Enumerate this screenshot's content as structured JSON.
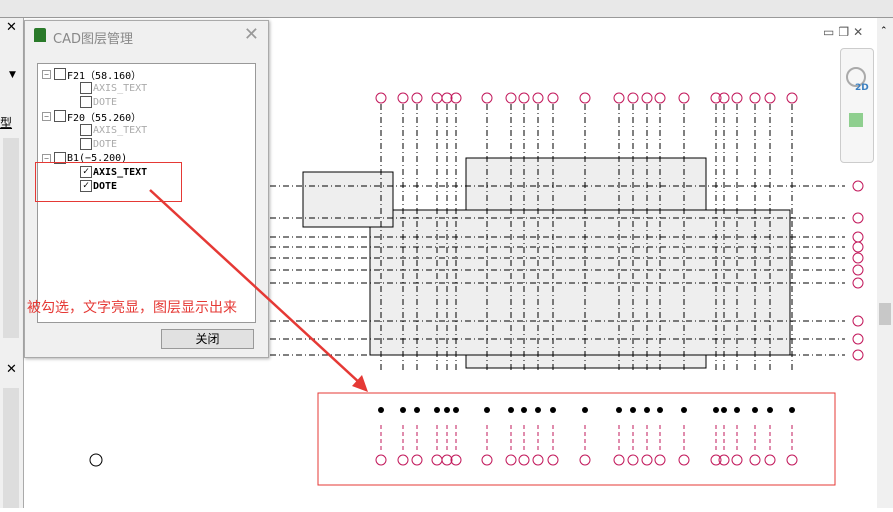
{
  "dialog": {
    "title": "CAD图层管理",
    "close_label": "关闭",
    "tree": [
      {
        "label": "F21（58.160）",
        "checked": false,
        "children": [
          {
            "label": "AXIS_TEXT",
            "checked": false
          },
          {
            "label": "DOTE",
            "checked": false
          }
        ]
      },
      {
        "label": "F20（55.260）",
        "checked": false,
        "children": [
          {
            "label": "AXIS_TEXT",
            "checked": false
          },
          {
            "label": "DOTE",
            "checked": false
          }
        ]
      },
      {
        "label": "B1(−5.200)",
        "checked": false,
        "children": [
          {
            "label": "AXIS_TEXT",
            "checked": true
          },
          {
            "label": "DOTE",
            "checked": true
          }
        ]
      }
    ]
  },
  "annotation": "被勾选，文字亮显，图层显示出来",
  "left_panel": {
    "label": "型"
  },
  "window_controls": {
    "minimize": "▭",
    "restore": "❐",
    "close": "✕"
  },
  "nav_bar": {
    "zoom_2d": "2D"
  },
  "colors": {
    "annotation": "#e53935",
    "axis_bubble": "#c2185b"
  }
}
